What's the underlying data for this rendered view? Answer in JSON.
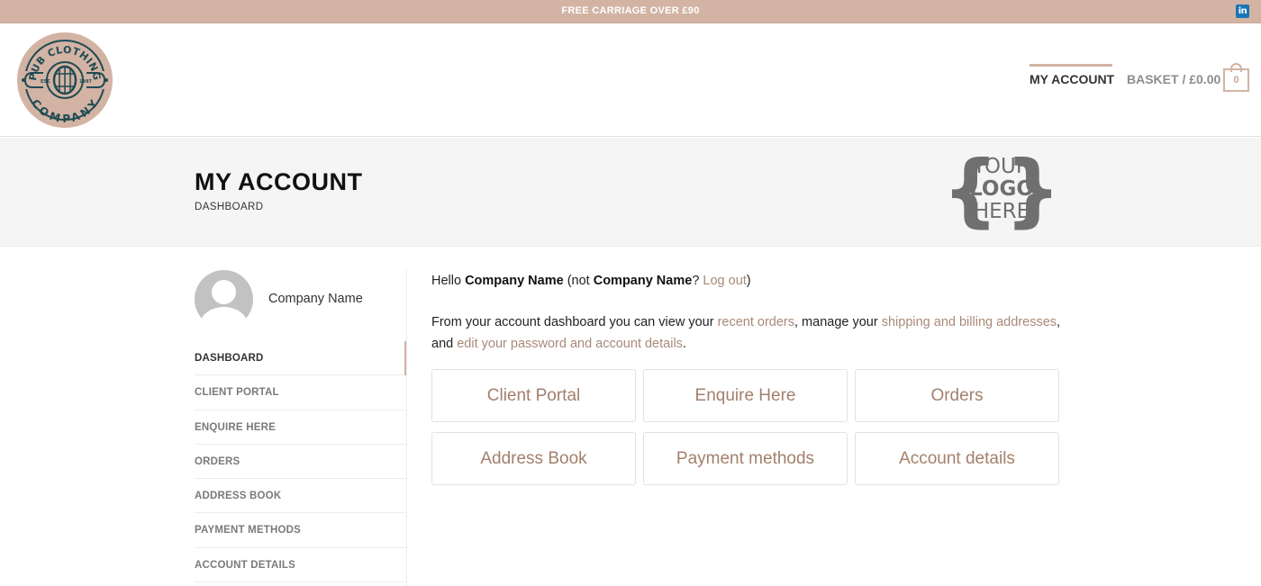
{
  "topbar": {
    "announcement": "FREE CARRIAGE OVER £90",
    "social_icon": "linkedin-icon",
    "social_label": "in"
  },
  "header": {
    "logo": {
      "top_text": "PUB CLOTHING",
      "bottom_text": "COMPANY",
      "est_left": "EST.",
      "est_right": "1997"
    },
    "nav": {
      "my_account": "MY ACCOUNT",
      "basket": "BASKET / £0.00",
      "basket_count": "0"
    }
  },
  "title_band": {
    "title": "MY ACCOUNT",
    "subtitle": "DASHBOARD",
    "placeholder_logo": {
      "line1": "YOUR",
      "line2": "LOGO",
      "line3": "HERE",
      "brace_left": "{",
      "brace_right": "}"
    }
  },
  "sidebar": {
    "profile_name": "Company Name",
    "items": [
      {
        "label": "DASHBOARD",
        "active": true
      },
      {
        "label": "CLIENT PORTAL",
        "active": false
      },
      {
        "label": "ENQUIRE HERE",
        "active": false
      },
      {
        "label": "ORDERS",
        "active": false
      },
      {
        "label": "ADDRESS BOOK",
        "active": false
      },
      {
        "label": "PAYMENT METHODS",
        "active": false
      },
      {
        "label": "ACCOUNT DETAILS",
        "active": false
      }
    ]
  },
  "main": {
    "greeting": {
      "hello": "Hello ",
      "name": "Company Name",
      "not_open": " (not ",
      "name2": "Company Name",
      "question": "? ",
      "logout": "Log out",
      "close": ")"
    },
    "intro": {
      "part1": "From your account dashboard you can view your ",
      "link1": "recent orders",
      "part2": ", manage your ",
      "link2": "shipping and billing addresses",
      "part3": ", and ",
      "link3": "edit your password and account details",
      "part4": "."
    },
    "tiles": [
      "Client Portal",
      "Enquire Here",
      "Orders",
      "Address Book",
      "Payment methods",
      "Account details"
    ]
  },
  "colors": {
    "accent": "#d3b3a4",
    "link": "#a98a78",
    "tile_text": "#a3806c",
    "logo_teal": "#1f4b53"
  }
}
